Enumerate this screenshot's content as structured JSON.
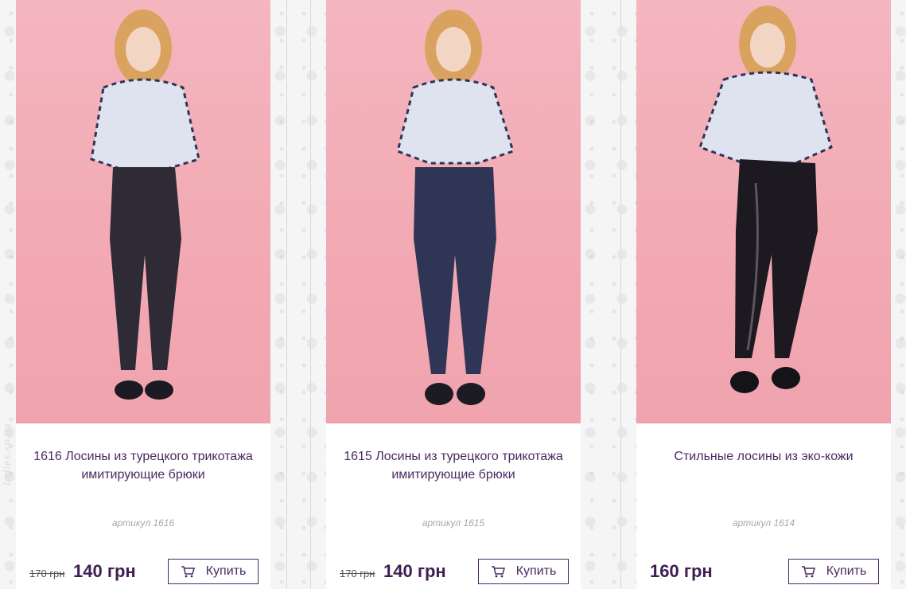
{
  "watermark": "ladies.sp.ua",
  "products": [
    {
      "title": "1616 Лосины из турецкого трикотажа имитирующие брюки",
      "article": "артикул 1616",
      "old_price": "170 грн",
      "price": "140 грн",
      "buy_label": "Купить",
      "pants_color": "#2e2a36"
    },
    {
      "title": "1615 Лосины из турецкого трикотажа имитирующие брюки",
      "article": "артикул 1615",
      "old_price": "170 грн",
      "price": "140 грн",
      "buy_label": "Купить",
      "pants_color": "#2f3554"
    },
    {
      "title": "Стильные лосины из эко-кожи",
      "article": "артикул 1614",
      "old_price": "",
      "price": "160 грн",
      "buy_label": "Купить",
      "pants_color": "#1c1a20"
    }
  ],
  "colors": {
    "accent": "#4a2a62",
    "price": "#3e1e52",
    "photo_bg": "#f2aab4"
  },
  "icons": {
    "cart": "cart-icon"
  }
}
